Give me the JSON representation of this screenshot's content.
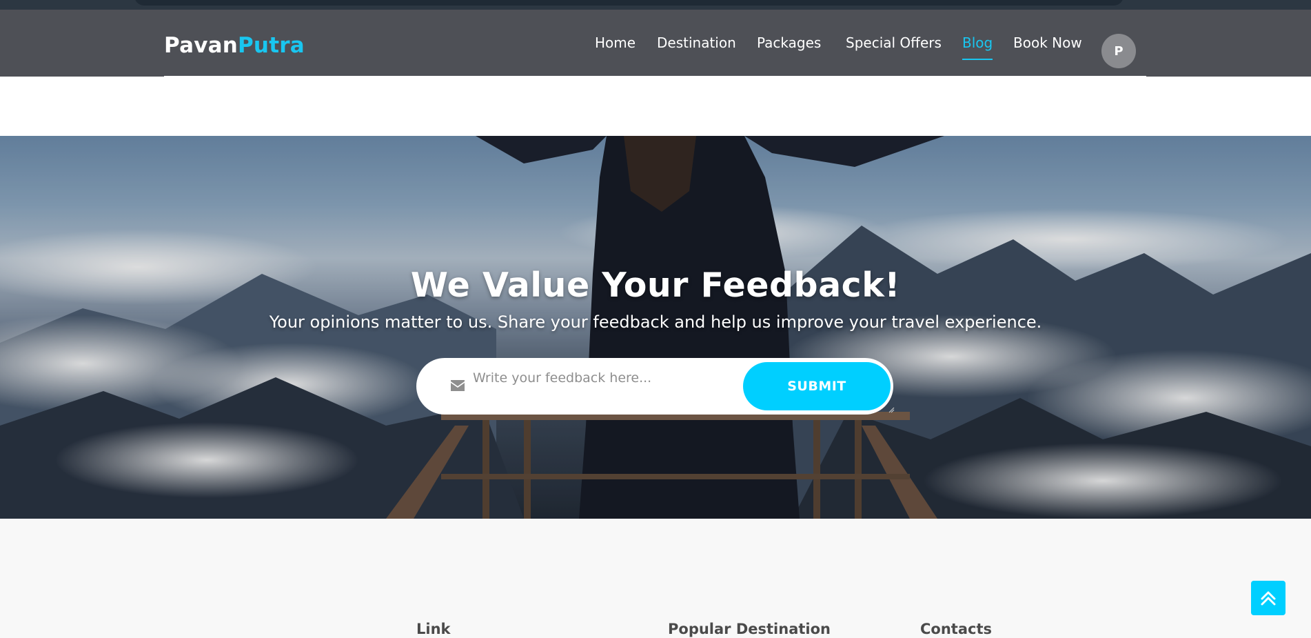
{
  "brand": {
    "part1": "Pavan",
    "part2": "Putra"
  },
  "nav": {
    "items": [
      {
        "label": "Home"
      },
      {
        "label": "Destination"
      },
      {
        "label": "Packages"
      },
      {
        "label": "Special Offers"
      },
      {
        "label": "Blog",
        "active": true
      },
      {
        "label": "Book Now"
      }
    ],
    "avatar_initial": "P"
  },
  "hero": {
    "title": "We Value Your Feedback!",
    "subtitle": "Your opinions matter to us. Share your feedback and help us improve your travel experience.",
    "input_placeholder": "Write your feedback here...",
    "submit_label": "SUBMIT",
    "input_icon": "envelope-icon"
  },
  "footer": {
    "headings": [
      "Link",
      "Popular Destination",
      "Contacts"
    ]
  },
  "scroll_top_icon": "double-chevron-up-icon",
  "colors": {
    "accent": "#00cfff",
    "navbar_bg": "#4e5056",
    "footer_bg": "#f8f8f8"
  }
}
